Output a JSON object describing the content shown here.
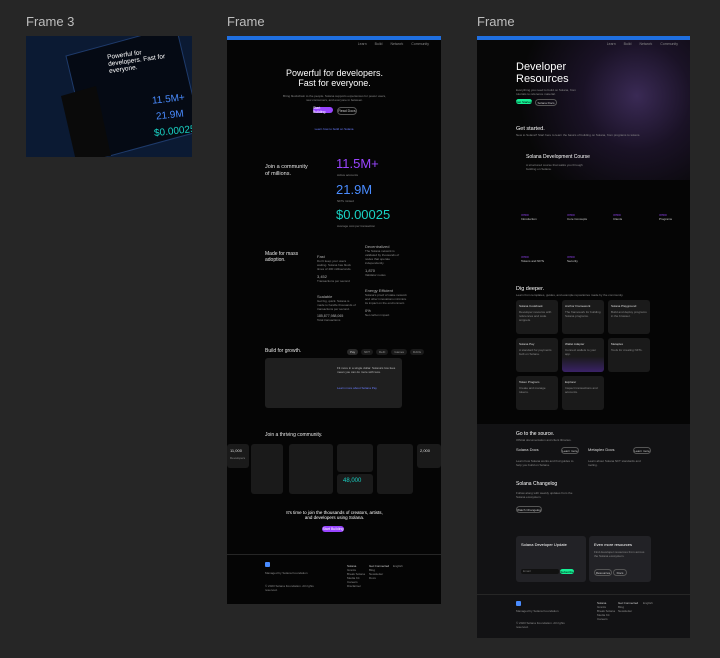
{
  "canvas": {
    "frames": [
      {
        "label": "Frame 3"
      },
      {
        "label": "Frame"
      },
      {
        "label": "Frame"
      }
    ]
  },
  "frame3": {
    "headline": "Powerful for developers. Fast for everyone.",
    "stats": [
      "11.5M+",
      "21.9M",
      "$0.00025"
    ]
  },
  "frame1": {
    "nav": [
      "Learn",
      "Build",
      "Network",
      "Community"
    ],
    "hero_title": "Powerful for developers. Fast for everyone.",
    "hero_sub": "Bring blockchain to the people. Solana supports experiences for power users, new consumers, and everyone in between.",
    "hero_primary": "Start Building",
    "hero_secondary": "Read Docs",
    "hero_link": "Learn how to build on Solana",
    "community_title": "Join a community of millions.",
    "stats": [
      {
        "value": "11.5M+",
        "label": "Active accounts",
        "color": "#9945ff"
      },
      {
        "value": "21.9M",
        "label": "NFTs minted",
        "color": "#4a8cff"
      },
      {
        "value": "$0.00025",
        "label": "Average cost per transaction",
        "color": "#19d3c5"
      }
    ],
    "adoption_title": "Made for mass adoption.",
    "features": [
      {
        "title": "Fast",
        "text": "Don't keep your users waiting. Solana has block times of 400 milliseconds."
      },
      {
        "title": "Decentralized",
        "text": "The Solana network is validated by thousands of nodes that operate independently."
      },
      {
        "title": "Scalable",
        "text": "Get big, quick. Solana is made to handle thousands of transactions per second."
      },
      {
        "title": "Energy Efficient",
        "text": "Solana's proof of stake network and other innovations minimize its impact on the environment."
      }
    ],
    "feature_stats": [
      {
        "value": "3,452",
        "label": "Transactions per second"
      },
      {
        "value": "1,870",
        "label": "Validator nodes"
      },
      {
        "value": "185,877,988,065",
        "label": "Total transactions"
      },
      {
        "value": "0%",
        "label": "Net carbon impact"
      }
    ],
    "build_title": "Build for growth.",
    "build_tabs": [
      "Pay",
      "NFT",
      "DeFi",
      "Games",
      "DAOs"
    ],
    "build_card_text": "Fit more in a single dollar. Solana's low fees mean you can do more with less.",
    "build_link": "Learn more about Solana Pay",
    "community2_title": "Join a thriving community.",
    "community_cards": [
      {
        "value": "11,000",
        "label": "Developers"
      },
      {
        "value": "2,000",
        "label": "Projects"
      },
      {
        "value": "48,000",
        "label": "Members"
      }
    ],
    "cta_title": "It's time to join the thousands of creators, artists, and developers using Solana.",
    "cta_button": "Start Building",
    "footer_brand": "Managed by Solana Foundation",
    "footer_copy": "© 2023 Solana Foundation. All rights reserved.",
    "footer_cols": [
      {
        "title": "Solana",
        "items": [
          "Grants",
          "Break Solana",
          "Media Kit",
          "Careers",
          "Disclaimer"
        ]
      },
      {
        "title": "Get Connected",
        "items": [
          "Blog",
          "Newsletter",
          "Docs"
        ]
      }
    ],
    "footer_lang": "English"
  },
  "frame2": {
    "nav": [
      "Learn",
      "Build",
      "Network",
      "Community"
    ],
    "hero_title": "Developer Resources",
    "hero_sub": "Everything you need to build on Solana, from tutorials to reference material.",
    "hero_primary": "Get Started",
    "hero_secondary": "Solana Docs",
    "getstarted_title": "Get started.",
    "getstarted_sub": "New to Solana? Start here to learn the basics of building on Solana, from programs to tokens.",
    "course_title": "Solana Development Course",
    "course_text": "A structured course that walks you through building on Solana.",
    "topics": [
      {
        "tag": "INTRO",
        "title": "Introduction"
      },
      {
        "tag": "INTRO",
        "title": "Core Concepts"
      },
      {
        "tag": "INTRO",
        "title": "Clients"
      },
      {
        "tag": "INTRO",
        "title": "Programs"
      },
      {
        "tag": "INTRO",
        "title": "Tokens and NFTs"
      },
      {
        "tag": "INTRO",
        "title": "Security"
      }
    ],
    "dig_title": "Dig deeper.",
    "dig_sub": "Learn from templates, guides, and example repositories made by the community.",
    "dig_cards": [
      {
        "title": "Solana Cookbook",
        "text": "Developer resource with references and code snippets.",
        "link": "Learn more"
      },
      {
        "title": "Anchor Framework",
        "text": "The framework for building Solana programs.",
        "link": "Learn more"
      },
      {
        "title": "Solana Playground",
        "text": "Build and deploy programs in the browser.",
        "link": "Learn more"
      },
      {
        "title": "Solana Pay",
        "text": "A standard for payments built on Solana.",
        "link": "Learn more"
      },
      {
        "title": "Wallet Adapter",
        "text": "Connect wallets to your app.",
        "link": "Learn more"
      },
      {
        "title": "Metaplex",
        "text": "Tools for creating NFTs.",
        "link": "Learn more"
      },
      {
        "title": "Token Program",
        "text": "Create and manage tokens.",
        "link": "Learn more"
      },
      {
        "title": "Explorer",
        "text": "Inspect transactions and accounts.",
        "link": "Learn more"
      }
    ],
    "source_title": "Go to the source.",
    "source_sub": "Official documentation and client libraries.",
    "source_items": [
      {
        "title": "Solana Docs",
        "button": "Learn more",
        "text": "Learn how Solana works and find guides to help you build on Solana."
      },
      {
        "title": "Metaplex Docs",
        "button": "Learn more",
        "text": "Learn about Solana NFT standards and tooling."
      }
    ],
    "changelog_title": "Solana Changelog",
    "changelog_text": "Follow along with weekly updates from the Solana ecosystem.",
    "changelog_button": "Watch Changelog",
    "newsletter_title": "Solana Developer Update",
    "newsletter_placeholder": "Email",
    "newsletter_button": "Subscribe",
    "more_title": "Even more resources",
    "more_text": "Find developer resources from across the Solana ecosystem.",
    "more_buttons": [
      "Resources",
      "Docs"
    ],
    "footer_brand": "Managed by Solana Foundation",
    "footer_copy": "© 2023 Solana Foundation. All rights reserved.",
    "footer_cols": [
      {
        "title": "Solana",
        "items": [
          "Grants",
          "Break Solana",
          "Media Kit",
          "Careers"
        ]
      },
      {
        "title": "Get Connected",
        "items": [
          "Blog",
          "Newsletter"
        ]
      }
    ],
    "footer_lang": "English"
  }
}
